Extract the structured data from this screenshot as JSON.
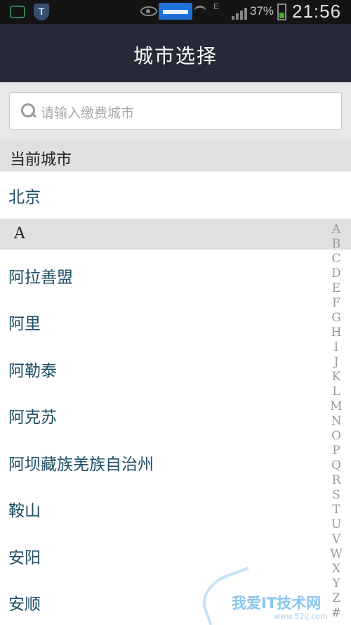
{
  "status_bar": {
    "battery_percent": "37%",
    "network_label": "E",
    "time": "21:56",
    "shield_glyph": "T"
  },
  "header": {
    "title": "城市选择"
  },
  "search": {
    "placeholder": "请输入缴费城市"
  },
  "current_section": {
    "label": "当前城市",
    "city": "北京"
  },
  "group": {
    "letter": "A",
    "cities": [
      "阿拉善盟",
      "阿里",
      "阿勒泰",
      "阿克苏",
      "阿坝藏族羌族自治州",
      "鞍山",
      "安阳",
      "安顺"
    ]
  },
  "index_letters": [
    "A",
    "B",
    "C",
    "D",
    "E",
    "F",
    "G",
    "H",
    "I",
    "J",
    "K",
    "L",
    "M",
    "N",
    "O",
    "P",
    "Q",
    "R",
    "S",
    "T",
    "U",
    "V",
    "W",
    "X",
    "Y",
    "Z",
    "#"
  ],
  "watermark": {
    "text": "我爱IT技术网",
    "url": "www.52ij.com"
  },
  "colors": {
    "title_bar": "#252a36",
    "city_text": "#1d4f66",
    "section_bg": "#e0e0e0"
  }
}
